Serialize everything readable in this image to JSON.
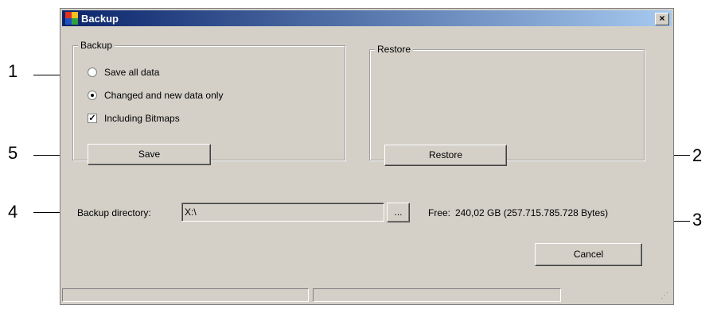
{
  "window": {
    "title": "Backup",
    "close_label": "×"
  },
  "backup_group": {
    "legend": "Backup",
    "options": {
      "save_all": "Save all data",
      "changed_only": "Changed and new data only",
      "bitmaps": "Including Bitmaps"
    },
    "selected": "changed_only",
    "bitmaps_checked": true,
    "save_label": "Save"
  },
  "restore_group": {
    "legend": "Restore",
    "restore_label": "Restore"
  },
  "directory": {
    "label": "Backup directory:",
    "value": "X:\\",
    "browse_label": "...",
    "free_label": "Free:",
    "free_value": "240,02 GB (257.715.785.728 Bytes)"
  },
  "cancel_label": "Cancel",
  "callouts": {
    "c1": "1",
    "c2": "2",
    "c3": "3",
    "c4": "4",
    "c5": "5"
  },
  "icons": {
    "app": "app-icon",
    "close": "close-icon",
    "grip": "resize-grip-icon"
  },
  "colors": {
    "dialog_bg": "#d4d0c8",
    "title_start": "#0a246a",
    "title_end": "#a6caf0"
  }
}
